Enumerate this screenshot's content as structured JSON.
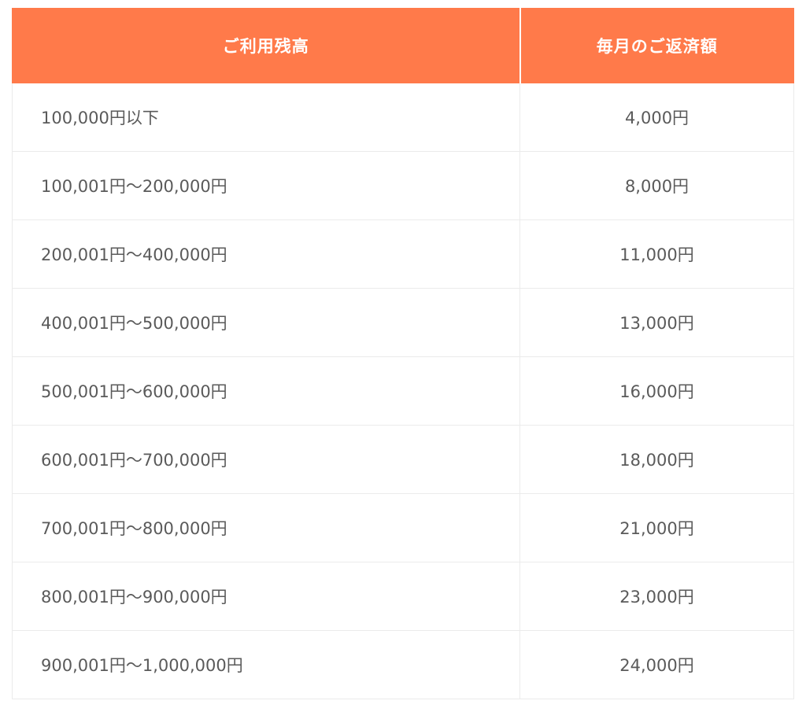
{
  "table": {
    "headers": {
      "balance": "ご利用残高",
      "payment": "毎月のご返済額"
    },
    "rows": [
      {
        "balance": "100,000円以下",
        "payment": "4,000円"
      },
      {
        "balance": "100,001円〜200,000円",
        "payment": "8,000円"
      },
      {
        "balance": "200,001円〜400,000円",
        "payment": "11,000円"
      },
      {
        "balance": "400,001円〜500,000円",
        "payment": "13,000円"
      },
      {
        "balance": "500,001円〜600,000円",
        "payment": "16,000円"
      },
      {
        "balance": "600,001円〜700,000円",
        "payment": "18,000円"
      },
      {
        "balance": "700,001円〜800,000円",
        "payment": "21,000円"
      },
      {
        "balance": "800,001円〜900,000円",
        "payment": "23,000円"
      },
      {
        "balance": "900,001円〜1,000,000円",
        "payment": "24,000円"
      }
    ]
  },
  "colors": {
    "header_bg": "#ff7a4a",
    "header_text": "#ffffff",
    "cell_text": "#5a5a5a",
    "border": "#ebebeb"
  }
}
